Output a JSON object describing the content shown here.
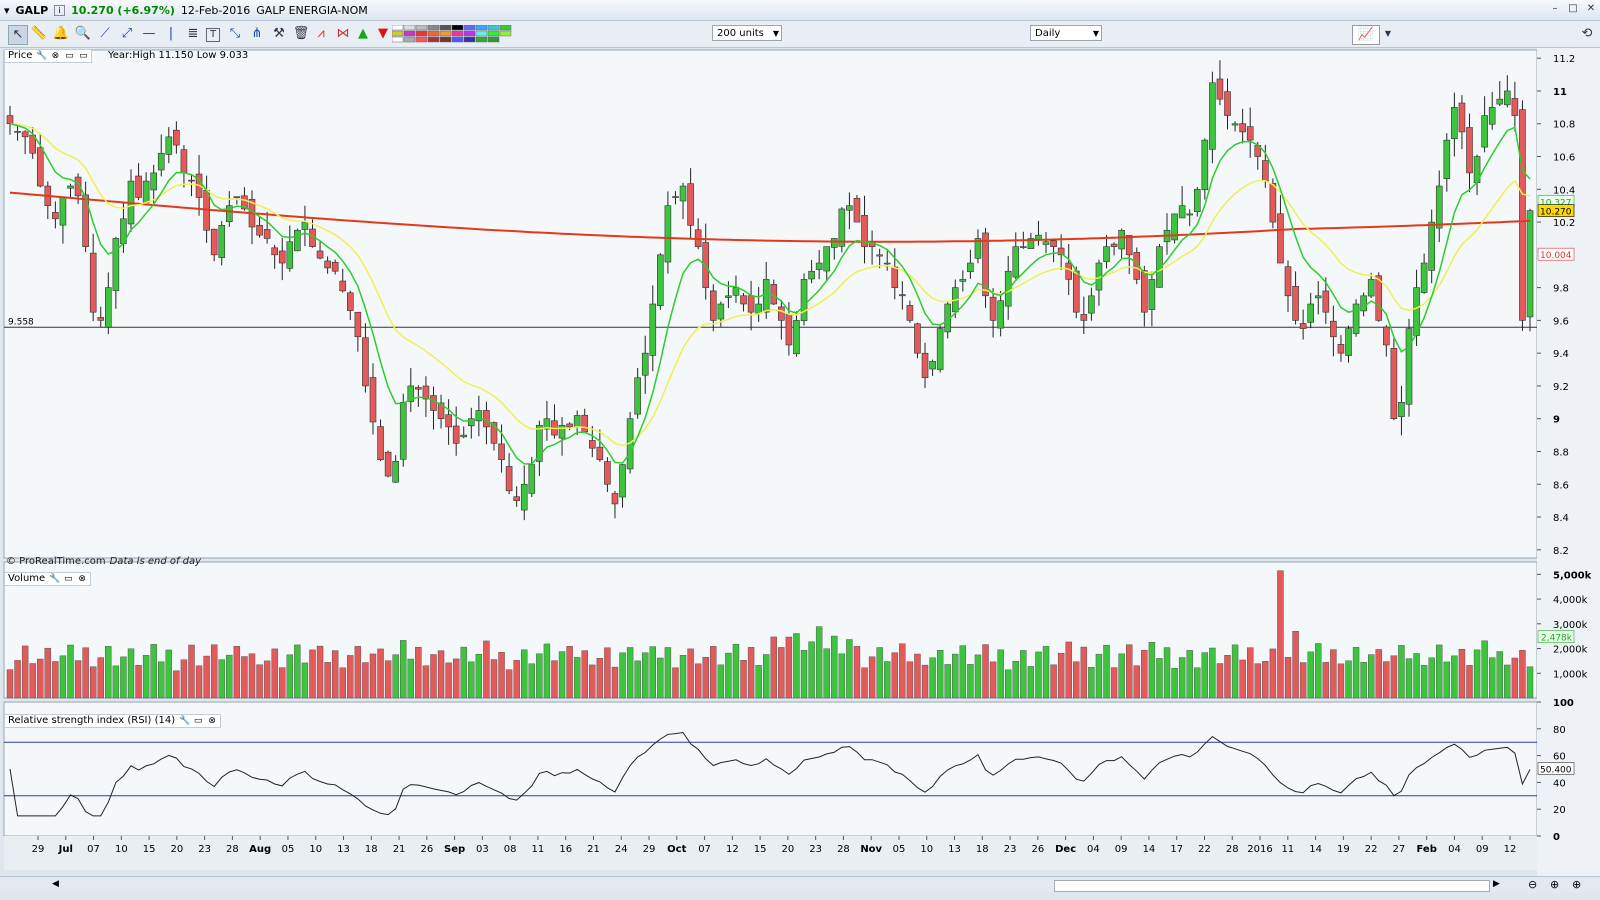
{
  "title": {
    "ticker": "GALP",
    "price_change": "10.270 (+6.97%)",
    "date": "12-Feb-2016",
    "name": "GALP ENERGIA-NOM"
  },
  "toolbar": {
    "units_select": "200 units",
    "period_select": "Daily"
  },
  "price_panel": {
    "label": "Price",
    "year_high_low": "Year:High 11.150 Low 9.033",
    "credit": "© ProRealTime.com",
    "credit_note": "Data is end of day",
    "hline_label": "9.558"
  },
  "volume_panel": {
    "label": "Volume"
  },
  "rsi_panel": {
    "label": "Relative strength index (RSI) (14)"
  },
  "colors": {
    "up": "#3ec33e",
    "down": "#e35a5a",
    "ma_fast": "#2ecc2e",
    "ma_mid": "#f0f050",
    "ma_slow": "#e03a1a",
    "rsi_bands": "#2b3aa8"
  },
  "chart_data": [
    {
      "type": "candlestick",
      "x_axis_labels": [
        "29",
        "Jul",
        "07",
        "10",
        "15",
        "20",
        "23",
        "28",
        "Aug",
        "05",
        "10",
        "13",
        "18",
        "21",
        "26",
        "Sep",
        "03",
        "08",
        "11",
        "16",
        "21",
        "24",
        "29",
        "Oct",
        "07",
        "12",
        "15",
        "20",
        "23",
        "28",
        "Nov",
        "05",
        "10",
        "13",
        "18",
        "23",
        "26",
        "Dec",
        "04",
        "09",
        "14",
        "17",
        "22",
        "28",
        "2016",
        "11",
        "14",
        "19",
        "22",
        "27",
        "Feb",
        "04",
        "09",
        "12"
      ],
      "y_ticks": [
        "11.2",
        "11",
        "10.8",
        "10.6",
        "10.4",
        "10.2",
        "9.8",
        "9.6",
        "9.4",
        "9.2",
        "9",
        "8.8",
        "8.6",
        "8.4",
        "8.2"
      ],
      "ylim": [
        8.15,
        11.25
      ],
      "last_value_labels": {
        "ma_fast": "10.327",
        "last_price": "10.270",
        "ma_slow": "10.004"
      },
      "horizontal_line": 9.558,
      "closes": [
        10.8,
        10.75,
        10.72,
        10.62,
        10.42,
        10.3,
        10.22,
        10.35,
        10.42,
        10.36,
        10.05,
        9.65,
        9.6,
        9.8,
        10.1,
        10.22,
        10.45,
        10.35,
        10.45,
        10.5,
        10.62,
        10.72,
        10.67,
        10.5,
        10.45,
        10.35,
        10.15,
        10.0,
        10.18,
        10.3,
        10.35,
        10.28,
        10.17,
        10.12,
        10.1,
        10.0,
        9.95,
        10.08,
        10.15,
        10.2,
        10.05,
        9.98,
        9.92,
        9.9,
        9.78,
        9.66,
        9.5,
        9.2,
        8.98,
        8.75,
        8.65,
        8.74,
        9.1,
        9.2,
        9.18,
        9.12,
        9.05,
        9.0,
        8.95,
        8.85,
        8.9,
        9.0,
        9.05,
        8.95,
        8.85,
        8.75,
        8.56,
        8.5,
        8.6,
        8.72,
        8.96,
        9.0,
        8.9,
        8.96,
        8.95,
        9.02,
        8.92,
        8.82,
        8.75,
        8.6,
        8.48,
        8.72,
        9.0,
        9.25,
        9.4,
        9.7,
        10.0,
        10.3,
        10.35,
        10.42,
        10.18,
        10.05,
        9.8,
        9.6,
        9.7,
        9.75,
        9.8,
        9.7,
        9.65,
        9.7,
        9.85,
        9.7,
        9.6,
        9.45,
        9.6,
        9.85,
        9.9,
        9.95,
        10.05,
        10.1,
        10.28,
        10.3,
        10.2,
        10.05,
        10.05,
        10.0,
        9.95,
        9.8,
        9.75,
        9.6,
        9.4,
        9.25,
        9.35,
        9.55,
        9.7,
        9.8,
        9.85,
        9.95,
        10.1,
        9.75,
        9.6,
        9.72,
        9.9,
        10.05,
        10.05,
        10.1,
        10.12,
        10.08,
        10.05,
        10.0,
        9.85,
        9.65,
        9.6,
        9.75,
        9.95,
        10.05,
        10.05,
        10.15,
        10.0,
        9.85,
        9.65,
        9.85,
        10.05,
        10.15,
        10.25,
        10.3,
        10.25,
        10.4,
        10.7,
        11.05,
        10.95,
        10.85,
        10.8,
        10.75,
        10.7,
        10.6,
        10.45,
        10.2,
        9.95,
        9.75,
        9.6,
        9.55,
        9.7,
        9.75,
        9.65,
        9.5,
        9.4,
        9.55,
        9.7,
        9.75,
        9.85,
        9.6,
        9.45,
        9.0,
        9.1,
        9.55,
        9.8,
        9.95,
        10.2,
        10.42,
        10.7,
        10.9,
        10.75,
        10.5,
        10.6,
        10.85,
        10.9,
        10.95,
        11.0,
        10.85,
        9.6,
        10.27
      ],
      "volume": {
        "type": "bar",
        "ylim": [
          0,
          5500
        ],
        "y_ticks": [
          "5,000k",
          "4,000k",
          "3,000k",
          "2,000k",
          "1,000k"
        ],
        "last_value_label": "2,478k"
      },
      "rsi": {
        "type": "line",
        "ylim": [
          0,
          100
        ],
        "y_ticks": [
          "100",
          "80",
          "60",
          "40",
          "20",
          "0"
        ],
        "bands": [
          70,
          30
        ],
        "last_value_label": "50.400"
      }
    }
  ]
}
